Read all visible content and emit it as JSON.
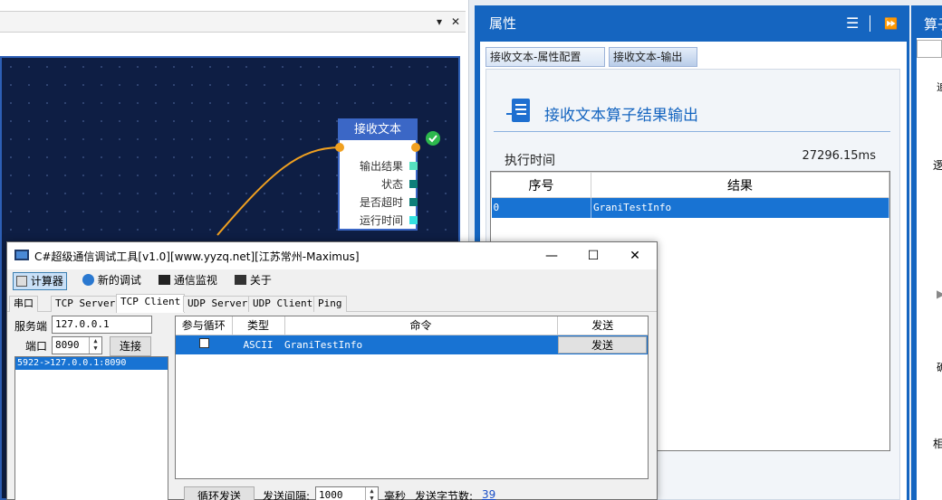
{
  "canvas": {
    "title_controls": {
      "dropdown": "▾",
      "close": "✕"
    },
    "node": {
      "title": "接收文本",
      "ports": [
        "输出结果",
        "状态",
        "是否超时",
        "运行时间"
      ],
      "port_colors": [
        "#56e0c0",
        "#0f7f7a",
        "#0f7f7a",
        "#35e0e0"
      ]
    }
  },
  "properties": {
    "title": "属性",
    "tabs": [
      "接收文本-属性配置",
      "接收文本-输出"
    ],
    "active_tab": 1,
    "output": {
      "heading": "接收文本算子结果输出",
      "exec_label": "执行时间",
      "exec_value": "27296.15ms",
      "columns": [
        "序号",
        "结果"
      ],
      "rows": [
        {
          "index": "0",
          "result": "GraniTestInfo"
        }
      ]
    }
  },
  "right_panel": {
    "title": "算子",
    "chars": [
      "追",
      "逻",
      "▶",
      "确",
      "相"
    ]
  },
  "dialog": {
    "title": "C#超级通信调试工具[v1.0][www.yyzq.net][江苏常州-Maximus]",
    "window_buttons": {
      "minimize": "—",
      "maximize": "☐",
      "close": "✕"
    },
    "toolbar": [
      "计算器",
      "新的调试",
      "通信监视",
      "关于"
    ],
    "tabs": [
      "串口",
      "TCP Server",
      "TCP Client",
      "UDP Server",
      "UDP Client",
      "Ping"
    ],
    "active_tab": 2,
    "server_label": "服务端",
    "server_value": "127.0.0.1",
    "port_label": "端口",
    "port_value": "8090",
    "connect_label": "连接",
    "connections": [
      "5922->127.0.0.1:8090"
    ],
    "cmd_columns": [
      "参与循环",
      "类型",
      "命令",
      "发送"
    ],
    "cmd_rows": [
      {
        "type": "ASCII",
        "command": "GraniTestInfo",
        "send": "发送"
      }
    ],
    "loop_send": "循环发送",
    "interval_label": "发送间隔:",
    "interval_value": "1000",
    "ms_label": "毫秒",
    "bytes_label": "发送字节数:",
    "bytes_value": "39"
  },
  "colors": {
    "accent": "#1565c0",
    "selection": "#1873d3",
    "canvas_bg": "#0e1e44",
    "success": "#2db84d"
  }
}
